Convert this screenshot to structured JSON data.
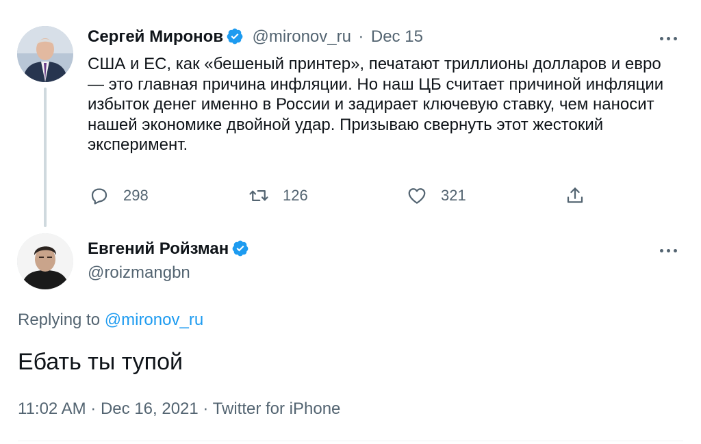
{
  "tweet": {
    "author_name": "Сергей Миронов",
    "author_handle": "@mironov_ru",
    "separator": "·",
    "date": "Dec 15",
    "text": "США и ЕС, как «бешеный принтер», печатают триллионы долларов и евро — это главная причина инфляции. Но наш ЦБ считает причиной инфляции избыток денег именно в России и задирает ключевую ставку, чем наносит нашей экономике двойной удар. Призываю свернуть этот жестокий эксперимент.",
    "actions": {
      "reply_count": "298",
      "retweet_count": "126",
      "like_count": "321"
    }
  },
  "reply": {
    "author_name": "Евгений Ройзман",
    "author_handle": "@roizmangbn",
    "replying_prefix": "Replying to",
    "replying_handle": "@mironov_ru",
    "text": "Ебать ты тупой",
    "time": "11:02 AM",
    "date": "Dec 16, 2021",
    "source": "Twitter for iPhone",
    "separator": "·"
  },
  "colors": {
    "accent": "#1d9bf0",
    "text": "#0f1419",
    "secondary": "#536471",
    "thread_line": "#cfd9de"
  }
}
